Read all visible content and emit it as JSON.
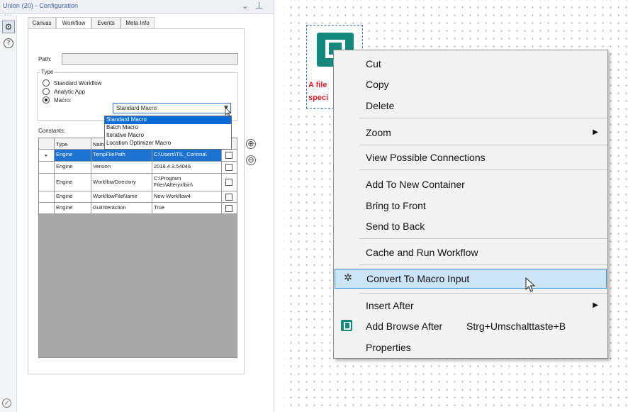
{
  "config_panel": {
    "title": "Union (20) - Configuration",
    "collapse_glyph": "⌄",
    "pin_glyph": "⊥",
    "side_icons": [
      "gear-icon",
      "help-icon",
      "check-icon"
    ],
    "tabs": [
      {
        "label": "Canvas"
      },
      {
        "label": "Workflow"
      },
      {
        "label": "Events"
      },
      {
        "label": "Meta Info"
      }
    ],
    "active_tab": "Workflow",
    "path_label": "Path:",
    "path_value": "",
    "type_legend": "Type",
    "type_options": [
      {
        "label": "Standard Workflow",
        "selected": false
      },
      {
        "label": "Analytic App",
        "selected": false
      },
      {
        "label": "Macro:",
        "selected": true
      }
    ],
    "macro_combo_value": "Standard Macro",
    "macro_dropdown_options": [
      {
        "label": "Standard Macro",
        "selected": true
      },
      {
        "label": "Batch Macro",
        "selected": false
      },
      {
        "label": "Iterative Macro",
        "selected": false
      },
      {
        "label": "Location Optimizer Macro",
        "selected": false
      }
    ],
    "constants_label": "Constants:",
    "constants_columns": [
      "Type",
      "Name",
      "",
      ""
    ],
    "constants_rows": [
      {
        "type": "Engine",
        "name": "TempFilePath",
        "value": "C:\\Users\\TIL_Corinna\\",
        "checked": false,
        "selected": true
      },
      {
        "type": "Engine",
        "name": "Version",
        "value": "2018.4.3.54046",
        "checked": false,
        "selected": false
      },
      {
        "type": "Engine",
        "name": "WorkflowDirectory",
        "value": "C:\\Program Files\\Alteryx\\bin\\",
        "checked": false,
        "selected": false
      },
      {
        "type": "Engine",
        "name": "WorkflowFileName",
        "value": "New Workflow4",
        "checked": false,
        "selected": false
      },
      {
        "type": "Engine",
        "name": "GuiInteraction",
        "value": "True",
        "checked": false,
        "selected": false
      }
    ],
    "add_button_glyph": "⊕",
    "remove_button_glyph": "⊖"
  },
  "canvas": {
    "tool_error_lines": [
      "A file",
      "speci"
    ]
  },
  "context_menu": {
    "items": [
      {
        "label": "Cut",
        "submenu": false
      },
      {
        "label": "Copy",
        "submenu": false
      },
      {
        "label": "Delete",
        "submenu": false
      },
      {
        "label": "Zoom",
        "submenu": true
      },
      {
        "label": "View Possible Connections",
        "submenu": false
      },
      {
        "label": "Add To New Container",
        "submenu": false
      },
      {
        "label": "Bring to Front",
        "submenu": false
      },
      {
        "label": "Send to Back",
        "submenu": false
      },
      {
        "label": "Cache and Run Workflow",
        "submenu": false
      },
      {
        "label": "Convert To Macro Input",
        "submenu": false,
        "highlighted": true,
        "icon": "macro-input-icon"
      },
      {
        "label": "Insert After",
        "submenu": true
      },
      {
        "label": "Add Browse After",
        "shortcut": "Strg+Umschalttaste+B",
        "submenu": false,
        "icon": "browse-tool-icon"
      },
      {
        "label": "Properties",
        "submenu": false
      }
    ],
    "submenu_glyph": "▶"
  },
  "colors": {
    "accent": "#3a5fa8",
    "tool_teal": "#13897b",
    "error_red": "#d61f26",
    "menu_highlight": "#cce4f7",
    "selection_blue": "#1e73d2"
  }
}
